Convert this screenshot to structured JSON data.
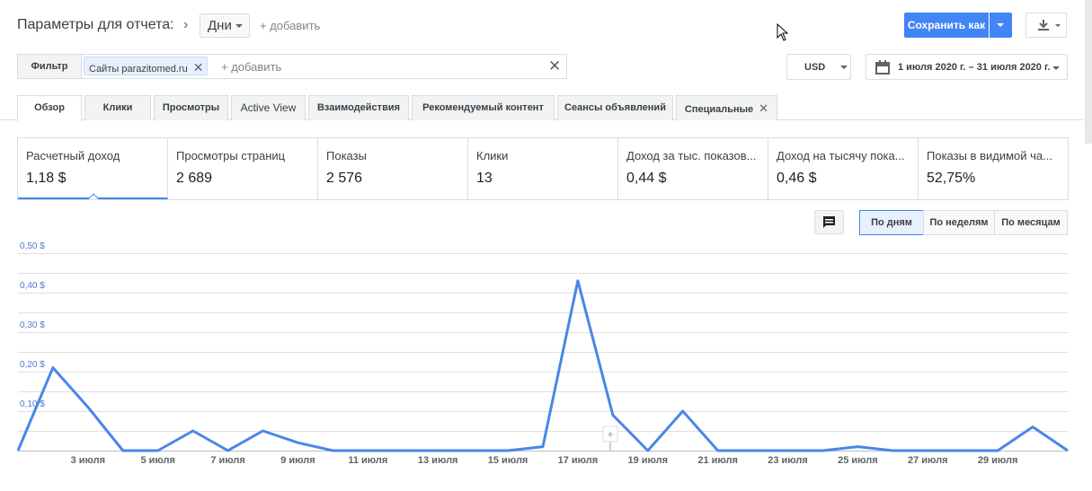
{
  "header": {
    "title": "Параметры для отчета:",
    "dimension": "Дни",
    "add_label": "+ добавить",
    "save_label": "Сохранить как"
  },
  "filter": {
    "label": "Фильтр",
    "chip": "Сайты parazitomed.ru",
    "add_label": "+ добавить"
  },
  "currency": "USD",
  "date_range": "1 июля 2020 г. – 31 июля 2020 г.",
  "tabs": [
    {
      "label": "Обзор"
    },
    {
      "label": "Клики"
    },
    {
      "label": "Просмотры"
    },
    {
      "label": "Active View"
    },
    {
      "label": "Взаимодействия"
    },
    {
      "label": "Рекомендуемый контент"
    },
    {
      "label": "Сеансы объявлений"
    },
    {
      "label": "Специальные"
    }
  ],
  "metrics": [
    {
      "label": "Расчетный доход",
      "value": "1,18 $"
    },
    {
      "label": "Просмотры страниц",
      "value": "2 689"
    },
    {
      "label": "Показы",
      "value": "2 576"
    },
    {
      "label": "Клики",
      "value": "13"
    },
    {
      "label": "Доход за тыс. показов...",
      "value": "0,44 $"
    },
    {
      "label": "Доход на тысячу пока...",
      "value": "0,46 $"
    },
    {
      "label": "Показы в видимой ча...",
      "value": "52,75%"
    }
  ],
  "periods": [
    "По дням",
    "По неделям",
    "По месяцам"
  ],
  "colors": {
    "accent": "#4285f4",
    "line": "#4a86e8"
  },
  "chart_data": {
    "type": "line",
    "y_tick_labels": [
      "0,10 $",
      "0,20 $",
      "0,30 $",
      "0,40 $",
      "0,50 $"
    ],
    "ylim": [
      0,
      0.5
    ],
    "x_tick_labels": [
      "3 июля",
      "5 июля",
      "7 июля",
      "9 июля",
      "11 июля",
      "13 июля",
      "15 июля",
      "17 июля",
      "19 июля",
      "21 июля",
      "23 июля",
      "25 июля",
      "27 июля",
      "29 июля"
    ],
    "series": [
      {
        "x": [
          1,
          2,
          3,
          4,
          5,
          6,
          7,
          8,
          9,
          10,
          11,
          12,
          13,
          14,
          15,
          16,
          17,
          18,
          19,
          20,
          21,
          22,
          23,
          24,
          25,
          26,
          27,
          28,
          29,
          30,
          31
        ],
        "values": [
          0,
          0.21,
          0.11,
          0,
          0,
          0.05,
          0,
          0.05,
          0.02,
          0,
          0,
          0,
          0,
          0,
          0,
          0.01,
          0.43,
          0.09,
          0,
          0.1,
          0,
          0,
          0,
          0,
          0.01,
          0,
          0,
          0,
          0,
          0.06,
          0
        ]
      }
    ],
    "grid": true
  }
}
